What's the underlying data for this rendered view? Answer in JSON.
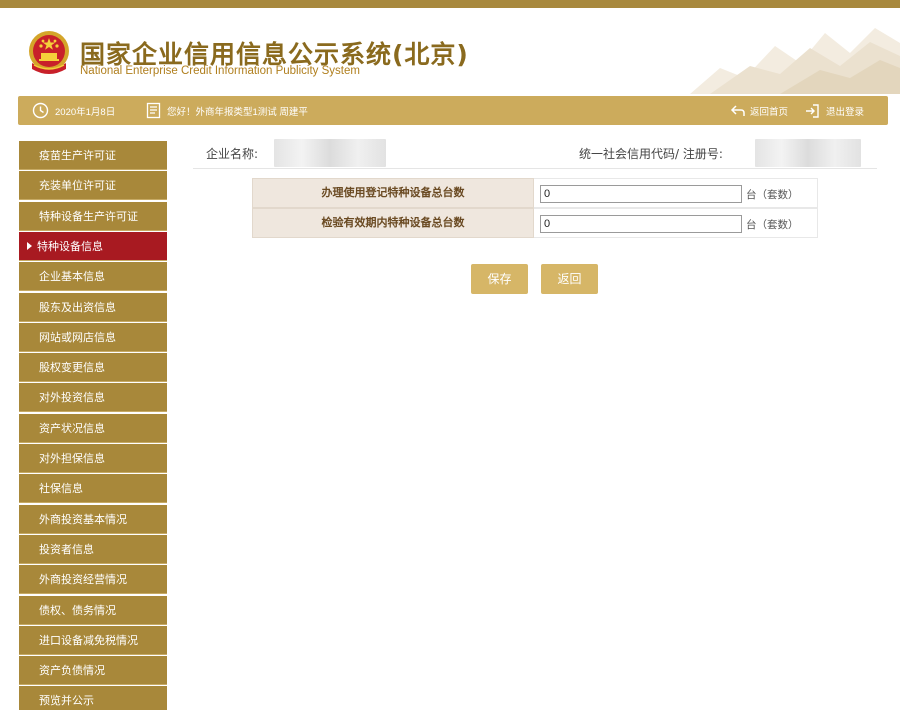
{
  "header": {
    "title_cn": "国家企业信用信息公示系统(北京)",
    "title_en": "National Enterprise Credit Information Publicity System"
  },
  "infobar": {
    "date": "2020年1月8日",
    "greeting": "您好！外商年报类型1测试  周建平",
    "home_label": "返回首页",
    "logout_label": "退出登录"
  },
  "sidebar": {
    "items": [
      {
        "label": "疫苗生产许可证"
      },
      {
        "label": "充装单位许可证"
      },
      {
        "label": "特种设备生产许可证"
      },
      {
        "label": "特种设备信息"
      },
      {
        "label": "企业基本信息"
      },
      {
        "label": "股东及出资信息"
      },
      {
        "label": "网站或网店信息"
      },
      {
        "label": "股权变更信息"
      },
      {
        "label": "对外投资信息"
      },
      {
        "label": "资产状况信息"
      },
      {
        "label": "对外担保信息"
      },
      {
        "label": "社保信息"
      },
      {
        "label": "外商投资基本情况"
      },
      {
        "label": "投资者信息"
      },
      {
        "label": "外商投资经营情况"
      },
      {
        "label": "债权、债务情况"
      },
      {
        "label": "进口设备减免税情况"
      },
      {
        "label": "资产负债情况"
      },
      {
        "label": "预览并公示"
      }
    ],
    "active_index": 3
  },
  "company": {
    "name_label": "企业名称:",
    "code_label": "统一社会信用代码/ 注册号:"
  },
  "form": {
    "rows": [
      {
        "label": "办理使用登记特种设备总台数",
        "value": "0",
        "unit": "台（套数）"
      },
      {
        "label": "检验有效期内特种设备总台数",
        "value": "0",
        "unit": "台（套数）"
      }
    ]
  },
  "buttons": {
    "save": "保存",
    "back": "返回"
  },
  "colors": {
    "gold": "#a8883a",
    "bar": "#ccab5c",
    "active": "#a81a21",
    "button": "#d6b667",
    "title": "#8a6a1e"
  }
}
